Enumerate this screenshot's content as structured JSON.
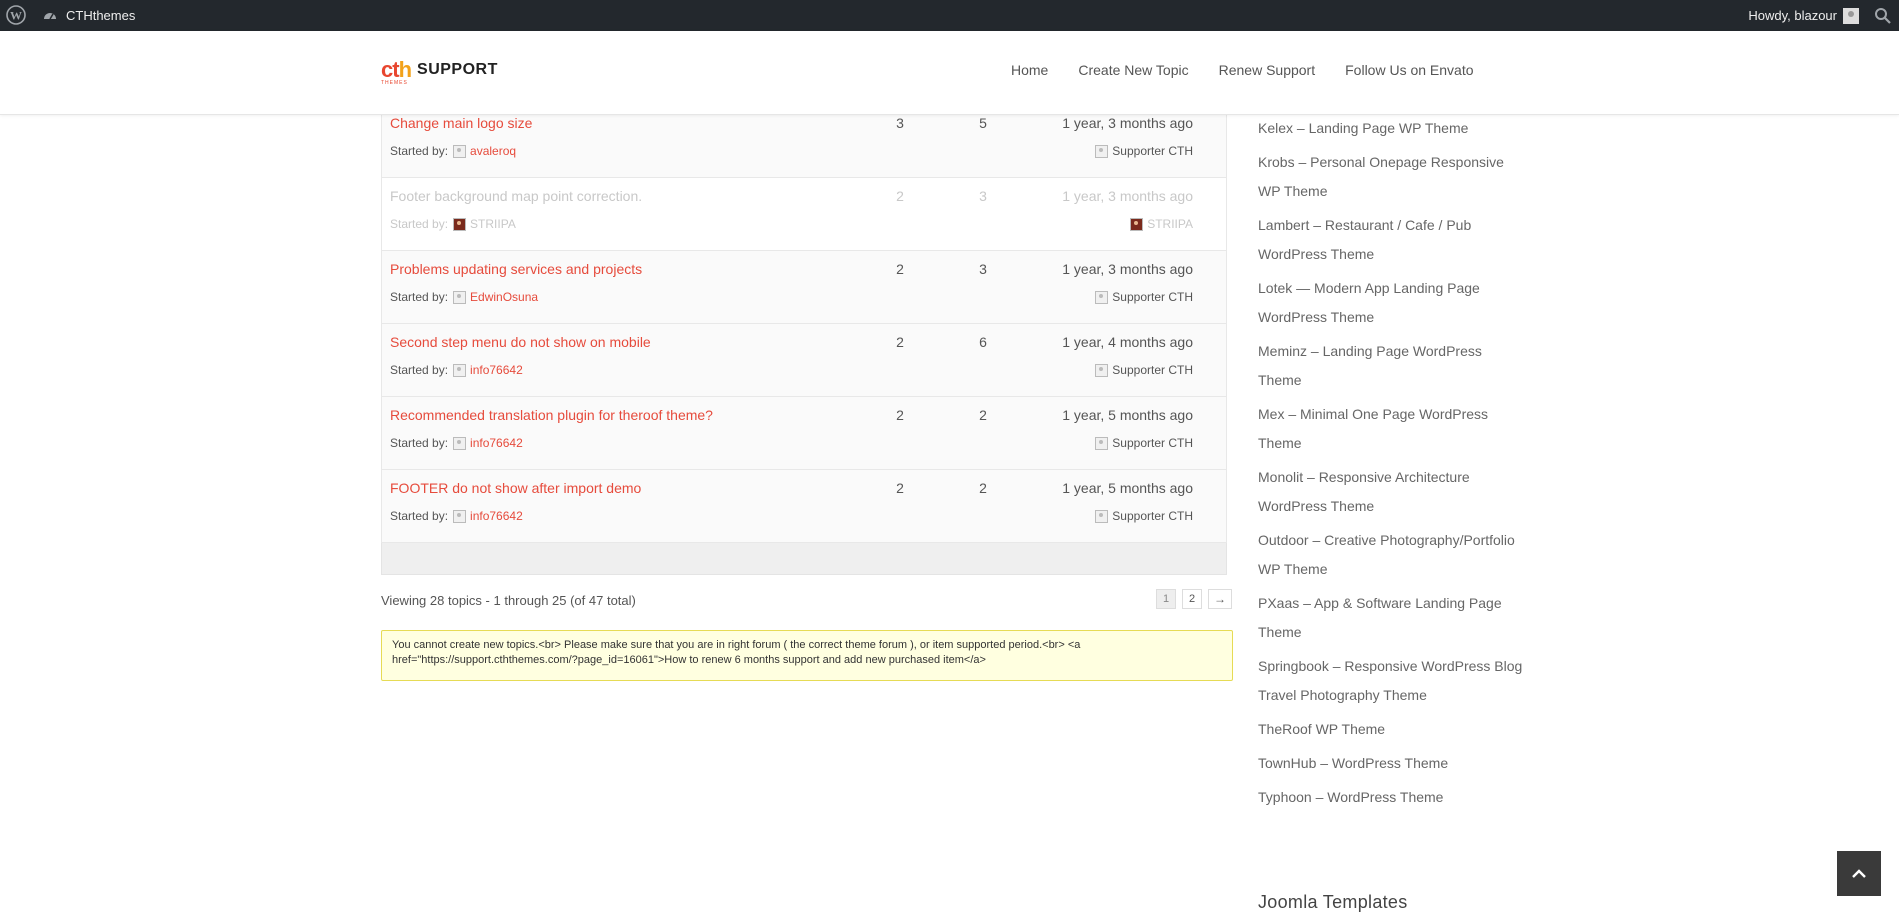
{
  "adminbar": {
    "site_name": "CTHthemes",
    "howdy": "Howdy, blazour"
  },
  "header": {
    "logo_word": "SUPPORT",
    "logo_mark": "cth",
    "logo_sub": "THEMES",
    "nav": [
      "Home",
      "Create New Topic",
      "Renew Support",
      "Follow Us on Envato"
    ]
  },
  "topics": [
    {
      "title": "Change main logo size",
      "started_label": "Started by:",
      "author": "avaleroq",
      "voices": "3",
      "posts": "5",
      "freshness": "1 year, 3 months ago",
      "last_by": "Supporter CTH",
      "closed": false
    },
    {
      "title": "Footer background map point correction.",
      "started_label": "Started by:",
      "author": "STRIIPA",
      "voices": "2",
      "posts": "3",
      "freshness": "1 year, 3 months ago",
      "last_by": "STRIIPA",
      "closed": true
    },
    {
      "title": "Problems updating services and projects",
      "started_label": "Started by:",
      "author": "EdwinOsuna",
      "voices": "2",
      "posts": "3",
      "freshness": "1 year, 3 months ago",
      "last_by": "Supporter CTH",
      "closed": false
    },
    {
      "title": "Second step menu do not show on mobile",
      "started_label": "Started by:",
      "author": "info76642",
      "voices": "2",
      "posts": "6",
      "freshness": "1 year, 4 months ago",
      "last_by": "Supporter CTH",
      "closed": false
    },
    {
      "title": "Recommended translation plugin for theroof theme?",
      "started_label": "Started by:",
      "author": "info76642",
      "voices": "2",
      "posts": "2",
      "freshness": "1 year, 5 months ago",
      "last_by": "Supporter CTH",
      "closed": false
    },
    {
      "title": "FOOTER do not show after import demo",
      "started_label": "Started by:",
      "author": "info76642",
      "voices": "2",
      "posts": "2",
      "freshness": "1 year, 5 months ago",
      "last_by": "Supporter CTH",
      "closed": false
    }
  ],
  "pagination": {
    "viewing": "Viewing 28 topics - 1 through 25 (of 47 total)",
    "pages": [
      "1",
      "2"
    ],
    "next": "→"
  },
  "notice": {
    "text": "You cannot create new topics.<br> Please make sure that you are in right forum ( the correct theme forum ), or item supported period.<br> <a href=\"https://support.cththemes.com/?page_id=16061\">How to renew 6 months support and add new purchased item</a>"
  },
  "sidebar": {
    "items": [
      "Kelex – Landing Page WP Theme",
      "Krobs – Personal Onepage Responsive WP Theme",
      "Lambert – Restaurant / Cafe / Pub WordPress Theme",
      "Lotek — Modern App Landing Page WordPress Theme",
      "Meminz – Landing Page WordPress Theme",
      "Mex – Minimal One Page WordPress Theme",
      "Monolit – Responsive Architecture WordPress Theme",
      "Outdoor – Creative Photography/Portfolio WP Theme",
      "PXaas – App & Software Landing Page Theme",
      "Springbook – Responsive WordPress Blog Travel Photography Theme",
      "TheRoof WP Theme",
      "TownHub – WordPress Theme",
      "Typhoon – WordPress Theme"
    ],
    "section_heading": "Joomla Templates"
  },
  "colors": {
    "accent": "#e64b3c",
    "adminbar": "#23282d",
    "notice_bg": "#ffffe0"
  }
}
